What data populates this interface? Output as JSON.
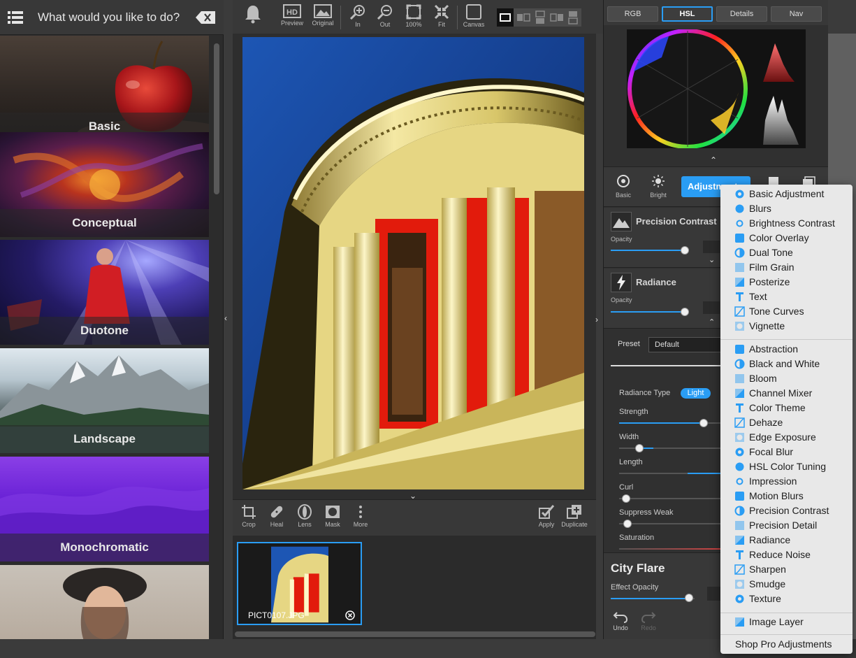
{
  "left_panel": {
    "search_placeholder": "What would you like to do?",
    "categories": [
      "Basic",
      "Conceptual",
      "Duotone",
      "Landscape",
      "Monochromatic"
    ]
  },
  "toolbar": {
    "preview": "Preview",
    "original": "Original",
    "zoom_in": "In",
    "zoom_out": "Out",
    "zoom_100": "100%",
    "fit": "Fit",
    "canvas": "Canvas"
  },
  "tools": {
    "crop": "Crop",
    "heal": "Heal",
    "lens": "Lens",
    "mask": "Mask",
    "more": "More",
    "apply": "Apply",
    "duplicate": "Duplicate"
  },
  "filmstrip": {
    "filename": "PICT0107.JPG"
  },
  "histogram_tabs": [
    "RGB",
    "HSL",
    "Details",
    "Nav"
  ],
  "histogram_active": "HSL",
  "filter_tabs": {
    "basic": "Basic",
    "bright": "Bright",
    "adjustments": "Adjustments"
  },
  "layers": [
    {
      "name": "Precision Contrast",
      "opacity_label": "Opacity"
    },
    {
      "name": "Radiance",
      "opacity_label": "Opacity"
    }
  ],
  "preset": {
    "label": "Preset",
    "value": "Default"
  },
  "controls": {
    "radiance_type_label": "Radiance Type",
    "radiance_type_value": "Light",
    "strength": "Strength",
    "width": "Width",
    "length": "Length",
    "curl": "Curl",
    "suppress_weak": "Suppress Weak",
    "saturation": "Saturation"
  },
  "effect": {
    "title": "City Flare",
    "opacity_label": "Effect Opacity",
    "undo": "Undo",
    "redo": "Redo"
  },
  "dropdown": {
    "group1": [
      "Basic Adjustment",
      "Blurs",
      "Brightness Contrast",
      "Color Overlay",
      "Dual Tone",
      "Film Grain",
      "Posterize",
      "Text",
      "Tone Curves",
      "Vignette"
    ],
    "group2": [
      "Abstraction",
      "Black and White",
      "Bloom",
      "Channel Mixer",
      "Color Theme",
      "Dehaze",
      "Edge Exposure",
      "Focal Blur",
      "HSL Color Tuning",
      "Impression",
      "Motion Blurs",
      "Precision Contrast",
      "Precision Detail",
      "Radiance",
      "Reduce Noise",
      "Sharpen",
      "Smudge",
      "Texture"
    ],
    "group3": [
      "Image Layer"
    ],
    "shop": "Shop Pro Adjustments"
  },
  "colors": {
    "accent": "#2a9df4",
    "panel": "#383838",
    "menu_bg": "#e8e8e8"
  }
}
